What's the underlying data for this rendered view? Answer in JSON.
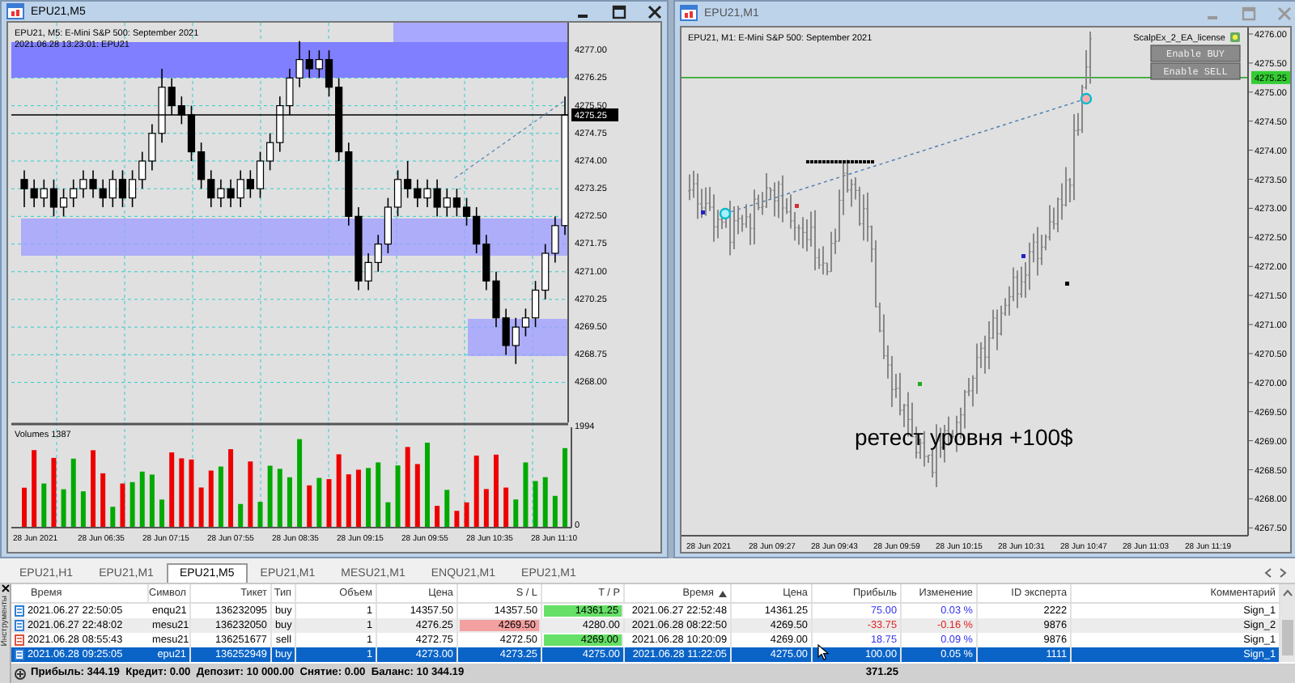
{
  "left_window": {
    "title": "EPU21,M5",
    "active": true,
    "info_lines": [
      "EPU21, M5:  E-Mini S&P 500: September 2021",
      "2021.06.28 13:23:01: EPU21"
    ],
    "current_price": "4275.25",
    "chart_data": {
      "type": "candlestick",
      "ylim": [
        4266.96,
        4277.75
      ],
      "grid": true,
      "yticks": [
        {
          "value": 4277,
          "label": "4277.00"
        },
        {
          "value": 4276.25,
          "label": "4276.25"
        },
        {
          "value": 4275.5,
          "label": "4275.50"
        },
        {
          "value": 4274.75,
          "label": "4274.75"
        },
        {
          "value": 4274,
          "label": "4274.00"
        },
        {
          "value": 4273.25,
          "label": "4273.25"
        },
        {
          "value": 4272.5,
          "label": "4272.50"
        },
        {
          "value": 4271.75,
          "label": "4271.75"
        },
        {
          "value": 4271,
          "label": "4271.00"
        },
        {
          "value": 4270.25,
          "label": "4270.25"
        },
        {
          "value": 4269.5,
          "label": "4269.50"
        },
        {
          "value": 4268.75,
          "label": "4268.75"
        },
        {
          "value": 4268,
          "label": "4268.00"
        }
      ],
      "categories": [
        null,
        null,
        null,
        null,
        null,
        null,
        null,
        null,
        null,
        null,
        null,
        null,
        null,
        null,
        null,
        null,
        null,
        null,
        null,
        null,
        null,
        null,
        null,
        null,
        null,
        null,
        null,
        null,
        null,
        null,
        null,
        null,
        null,
        null,
        null,
        null,
        null,
        null,
        null,
        null,
        null,
        null,
        null,
        null,
        null,
        null,
        null,
        null,
        null,
        null,
        null,
        null,
        null,
        null,
        null,
        null
      ],
      "ohlc": [
        [
          4273.5,
          4273.75,
          4272.75,
          4273.25
        ],
        [
          4273.25,
          4273.5,
          4272.75,
          4273.0
        ],
        [
          4273.0,
          4273.5,
          4272.75,
          4273.25
        ],
        [
          4273.25,
          4273.5,
          4272.5,
          4272.75
        ],
        [
          4272.75,
          4273.25,
          4272.5,
          4273.0
        ],
        [
          4273.0,
          4273.5,
          4272.75,
          4273.25
        ],
        [
          4273.25,
          4273.75,
          4273.0,
          4273.5
        ],
        [
          4273.5,
          4273.75,
          4273.0,
          4273.25
        ],
        [
          4273.25,
          4273.5,
          4272.75,
          4273.0
        ],
        [
          4273.0,
          4273.75,
          4272.75,
          4273.5
        ],
        [
          4273.5,
          4273.75,
          4272.75,
          4273.0
        ],
        [
          4273.0,
          4273.75,
          4272.75,
          4273.5
        ],
        [
          4273.5,
          4274.25,
          4273.25,
          4274.0
        ],
        [
          4274.0,
          4275.0,
          4273.75,
          4274.75
        ],
        [
          4274.75,
          4276.5,
          4274.5,
          4276.0
        ],
        [
          4276.0,
          4276.25,
          4275.25,
          4275.5
        ],
        [
          4275.5,
          4275.75,
          4275.0,
          4275.25
        ],
        [
          4275.25,
          4275.5,
          4274.0,
          4274.25
        ],
        [
          4274.25,
          4274.5,
          4273.25,
          4273.5
        ],
        [
          4273.5,
          4273.75,
          4272.75,
          4273.0
        ],
        [
          4273.0,
          4273.5,
          4272.75,
          4273.25
        ],
        [
          4273.25,
          4273.5,
          4272.75,
          4273.0
        ],
        [
          4273.0,
          4273.75,
          4272.75,
          4273.5
        ],
        [
          4273.5,
          4273.75,
          4273.0,
          4273.25
        ],
        [
          4273.25,
          4274.25,
          4273.0,
          4274.0
        ],
        [
          4274.0,
          4274.75,
          4273.75,
          4274.5
        ],
        [
          4274.5,
          4275.75,
          4274.25,
          4275.5
        ],
        [
          4275.5,
          4276.5,
          4275.25,
          4276.25
        ],
        [
          4276.25,
          4277.25,
          4276.0,
          4276.75
        ],
        [
          4276.75,
          4277.0,
          4276.25,
          4276.5
        ],
        [
          4276.5,
          4277.0,
          4276.25,
          4276.75
        ],
        [
          4276.75,
          4277.0,
          4275.75,
          4276.0
        ],
        [
          4276.0,
          4276.25,
          4274.0,
          4274.25
        ],
        [
          4274.25,
          4274.5,
          4272.25,
          4272.5
        ],
        [
          4272.5,
          4272.75,
          4270.5,
          4270.75
        ],
        [
          4270.75,
          4271.5,
          4270.5,
          4271.25
        ],
        [
          4271.25,
          4272.0,
          4271.0,
          4271.75
        ],
        [
          4271.75,
          4273.0,
          4271.5,
          4272.75
        ],
        [
          4272.75,
          4273.75,
          4272.5,
          4273.5
        ],
        [
          4273.5,
          4274.0,
          4273.0,
          4273.25
        ],
        [
          4273.25,
          4273.5,
          4272.75,
          4273.0
        ],
        [
          4273.0,
          4273.5,
          4272.75,
          4273.25
        ],
        [
          4273.25,
          4273.5,
          4272.5,
          4272.75
        ],
        [
          4272.75,
          4273.25,
          4272.5,
          4273.0
        ],
        [
          4273.0,
          4273.25,
          4272.5,
          4272.75
        ],
        [
          4272.75,
          4273.0,
          4272.25,
          4272.5
        ],
        [
          4272.5,
          4272.75,
          4271.5,
          4271.75
        ],
        [
          4271.75,
          4272.0,
          4270.5,
          4270.75
        ],
        [
          4270.75,
          4271.0,
          4269.5,
          4269.75
        ],
        [
          4269.75,
          4270.0,
          4268.75,
          4269.0
        ],
        [
          4269.0,
          4269.75,
          4268.5,
          4269.5
        ],
        [
          4269.5,
          4270.0,
          4269.25,
          4269.75
        ],
        [
          4269.75,
          4270.75,
          4269.5,
          4270.5
        ],
        [
          4270.5,
          4271.75,
          4270.25,
          4271.5
        ],
        [
          4271.5,
          4272.5,
          4271.25,
          4272.25
        ],
        [
          4272.25,
          4275.75,
          4272.0,
          4275.25
        ]
      ]
    },
    "volume_title": "Volumes 1387",
    "volume_max": "1994",
    "volume_min": "0",
    "time_labels": [
      "28 Jun 2021",
      "28 Jun 06:35",
      "28 Jun 07:15",
      "28 Jun 07:55",
      "28 Jun 08:35",
      "28 Jun 09:15",
      "28 Jun 09:55",
      "28 Jun 10:35",
      "28 Jun 11:10"
    ]
  },
  "right_window": {
    "title": "EPU21,M1",
    "active": false,
    "info_line": "EPU21, M1:  E-Mini S&P 500: September 2021",
    "ea_label": "ScalpEx_2_EA_license",
    "buttons": [
      "Enable BUY",
      "Enable SELL"
    ],
    "price_labels": [
      "4276.00",
      "4275.50",
      "4275.00",
      "4274.50",
      "4274.00",
      "4273.50",
      "4273.00",
      "4272.50",
      "4272.00",
      "4271.50",
      "4271.00",
      "4270.50",
      "4270.00",
      "4269.50",
      "4269.00",
      "4268.50",
      "4268.00",
      "4267.50"
    ],
    "current_price": "4275.25",
    "annotation": "ретест уровня +100$",
    "time_labels": [
      "28 Jun 2021",
      "28 Jun 09:27",
      "28 Jun 09:43",
      "28 Jun 09:59",
      "28 Jun 10:15",
      "28 Jun 10:31",
      "28 Jun 10:47",
      "28 Jun 11:03",
      "28 Jun 11:19"
    ]
  },
  "chart_tabs": [
    {
      "label": "EPU21,H1",
      "selected": false
    },
    {
      "label": "EPU21,M1",
      "selected": false
    },
    {
      "label": "EPU21,M5",
      "selected": true
    },
    {
      "label": "EPU21,M1",
      "selected": false
    },
    {
      "label": "MESU21,M1",
      "selected": false
    },
    {
      "label": "ENQU21,M1",
      "selected": false
    },
    {
      "label": "EPU21,M1",
      "selected": false
    }
  ],
  "side_panel": {
    "label": "Инструменты"
  },
  "table": {
    "columns": [
      {
        "label": "Время",
        "sorted": false
      },
      {
        "label": "Символ",
        "sorted": false
      },
      {
        "label": "Тикет",
        "sorted": false
      },
      {
        "label": "Тип",
        "sorted": false
      },
      {
        "label": "Объем",
        "sorted": false
      },
      {
        "label": "Цена",
        "sorted": false
      },
      {
        "label": "S / L",
        "sorted": false
      },
      {
        "label": "T / P",
        "sorted": false
      },
      {
        "label": "Время",
        "sorted": true
      },
      {
        "label": "Цена",
        "sorted": false
      },
      {
        "label": "Прибыль",
        "sorted": false
      },
      {
        "label": "Изменение",
        "sorted": false
      },
      {
        "label": "ID эксперта",
        "sorted": false
      },
      {
        "label": "Комментарий",
        "sorted": false
      }
    ],
    "rows": [
      {
        "kind": "buy",
        "selected": false,
        "sl_hit": false,
        "tp_hit": true,
        "loss": false,
        "cells": [
          "2021.06.27 22:50:05",
          "enqu21",
          "136232095",
          "buy",
          "1",
          "14357.50",
          "14357.50",
          "14361.25",
          "2021.06.27 22:52:48",
          "14361.25",
          "75.00",
          "0.03 %",
          "2222",
          "Sign_1"
        ]
      },
      {
        "kind": "buy",
        "selected": false,
        "sl_hit": true,
        "tp_hit": false,
        "loss": true,
        "cells": [
          "2021.06.27 22:48:02",
          "mesu21",
          "136232050",
          "buy",
          "1",
          "4276.25",
          "4269.50",
          "4280.00",
          "2021.06.28 08:22:50",
          "4269.50",
          "-33.75",
          "-0.16 %",
          "9876",
          "Sign_2"
        ]
      },
      {
        "kind": "sell",
        "selected": false,
        "sl_hit": false,
        "tp_hit": true,
        "loss": false,
        "cells": [
          "2021.06.28 08:55:43",
          "mesu21",
          "136251677",
          "sell",
          "1",
          "4272.75",
          "4272.50",
          "4269.00",
          "2021.06.28 10:20:09",
          "4269.00",
          "18.75",
          "0.09 %",
          "9876",
          "Sign_1"
        ]
      },
      {
        "kind": "buy",
        "selected": true,
        "sl_hit": false,
        "tp_hit": false,
        "loss": false,
        "cells": [
          "2021.06.28 09:25:05",
          "epu21",
          "136252949",
          "buy",
          "1",
          "4273.00",
          "4273.25",
          "4275.00",
          "2021.06.28 11:22:05",
          "4275.00",
          "100.00",
          "0.05 %",
          "1111",
          "Sign_1"
        ]
      }
    ],
    "footer": {
      "summary": "Прибыль: 344.19  Кредит: 0.00  Депозит: 10 000.00  Снятие: 0.00  Баланс: 10 344.19",
      "total": "371.25"
    }
  }
}
